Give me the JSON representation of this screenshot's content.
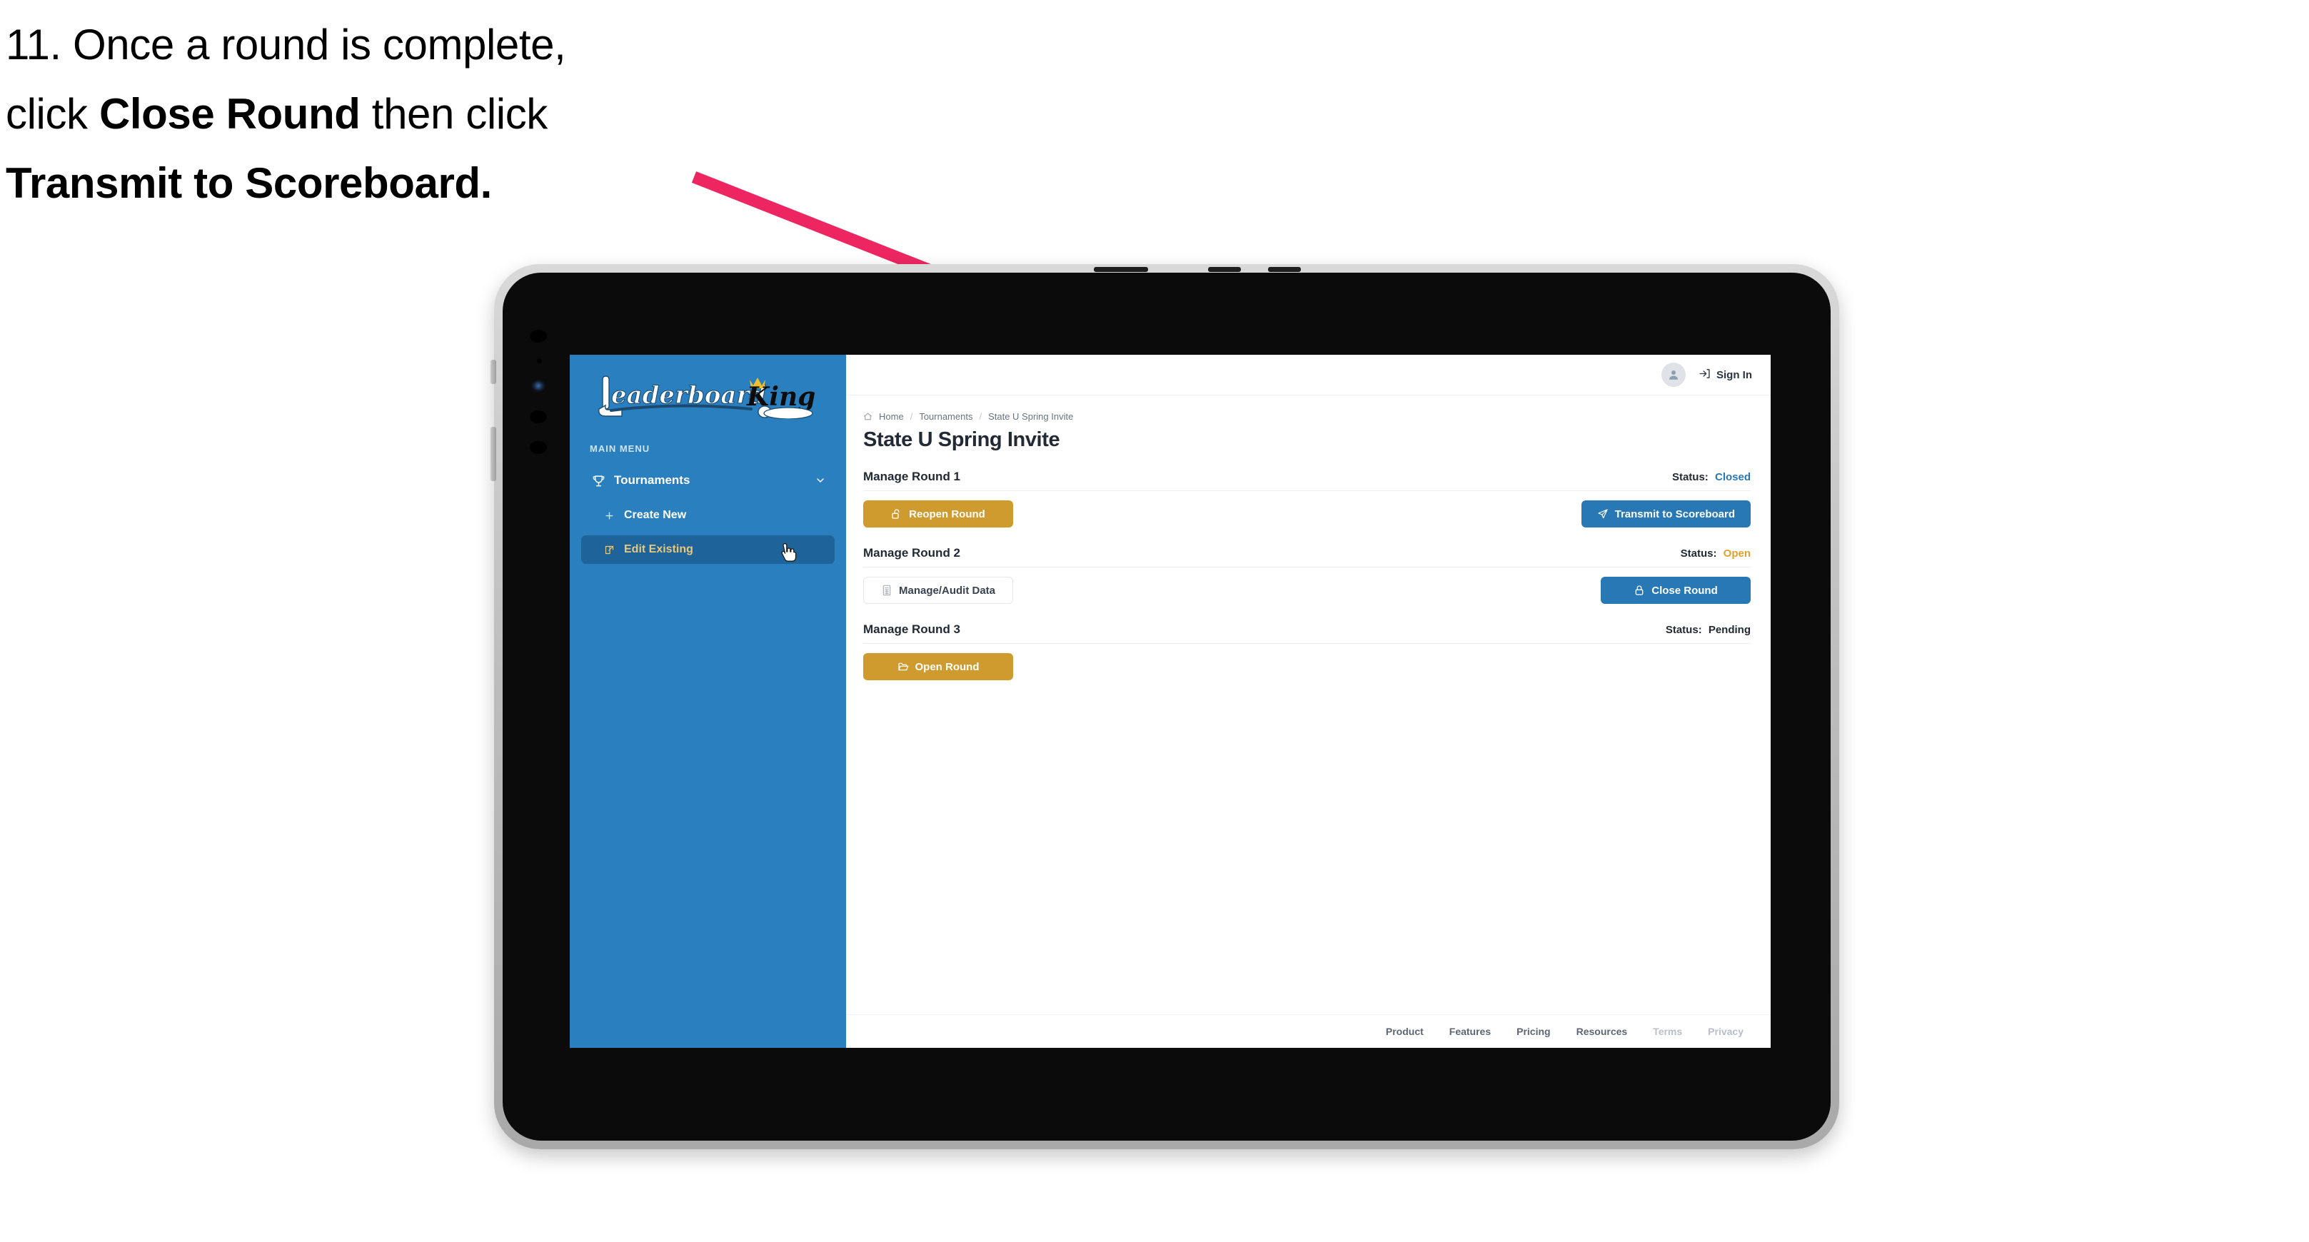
{
  "caption": {
    "line1_plain": "11. Once a round is complete,",
    "line2_pre": "click ",
    "line2_bold": "Close Round",
    "line2_post": " then click",
    "line3_bold": "Transmit to Scoreboard."
  },
  "annotation": {
    "arrow_color": "#ed2662"
  },
  "app": {
    "logo": {
      "word_left": "Leaderboard",
      "word_right": "King",
      "icon": "golf-putter-icon",
      "crown_icon": "crown-icon"
    },
    "sidebar": {
      "section_label": "MAIN MENU",
      "bg_color": "#2a7fbf",
      "active_bg_color": "#1e6399",
      "active_text_color": "#e8c87a",
      "items": [
        {
          "label": "Tournaments",
          "icon": "trophy-icon",
          "trailing_icon": "chevron-down-icon",
          "active": false
        },
        {
          "label": "Create New",
          "icon": "plus-icon",
          "active": false
        },
        {
          "label": "Edit Existing",
          "icon": "edit-square-icon",
          "active": true
        }
      ]
    },
    "topbar": {
      "avatar_icon": "user-avatar-icon",
      "signin_icon": "sign-in-arrow-icon",
      "signin_label": "Sign In"
    },
    "breadcrumb": {
      "home_icon": "home-icon",
      "items": [
        "Home",
        "Tournaments",
        "State U Spring Invite"
      ],
      "separator": "/"
    },
    "page_title": "State U Spring Invite",
    "rounds": [
      {
        "title": "Manage Round 1",
        "status_label": "Status:",
        "status_value": "Closed",
        "status_color": "#2878b5",
        "left_button": {
          "label": "Reopen Round",
          "icon": "unlock-icon",
          "style": "gold"
        },
        "right_button": {
          "label": "Transmit to Scoreboard",
          "icon": "paper-plane-icon",
          "style": "blue"
        }
      },
      {
        "title": "Manage Round 2",
        "status_label": "Status:",
        "status_value": "Open",
        "status_color": "#e0a12c",
        "left_button": {
          "label": "Manage/Audit Data",
          "icon": "calculator-icon",
          "style": "ghost"
        },
        "right_button": {
          "label": "Close Round",
          "icon": "lock-icon",
          "style": "blue"
        }
      },
      {
        "title": "Manage Round 3",
        "status_label": "Status:",
        "status_value": "Pending",
        "status_color": "#222a35",
        "left_button": {
          "label": "Open Round",
          "icon": "open-folder-icon",
          "style": "gold"
        },
        "right_button": null
      }
    ],
    "footer": {
      "links": [
        {
          "label": "Product",
          "muted": false
        },
        {
          "label": "Features",
          "muted": false
        },
        {
          "label": "Pricing",
          "muted": false
        },
        {
          "label": "Resources",
          "muted": false
        },
        {
          "label": "Terms",
          "muted": true
        },
        {
          "label": "Privacy",
          "muted": true
        }
      ]
    },
    "cursor": {
      "icon": "pointing-hand-cursor"
    }
  }
}
